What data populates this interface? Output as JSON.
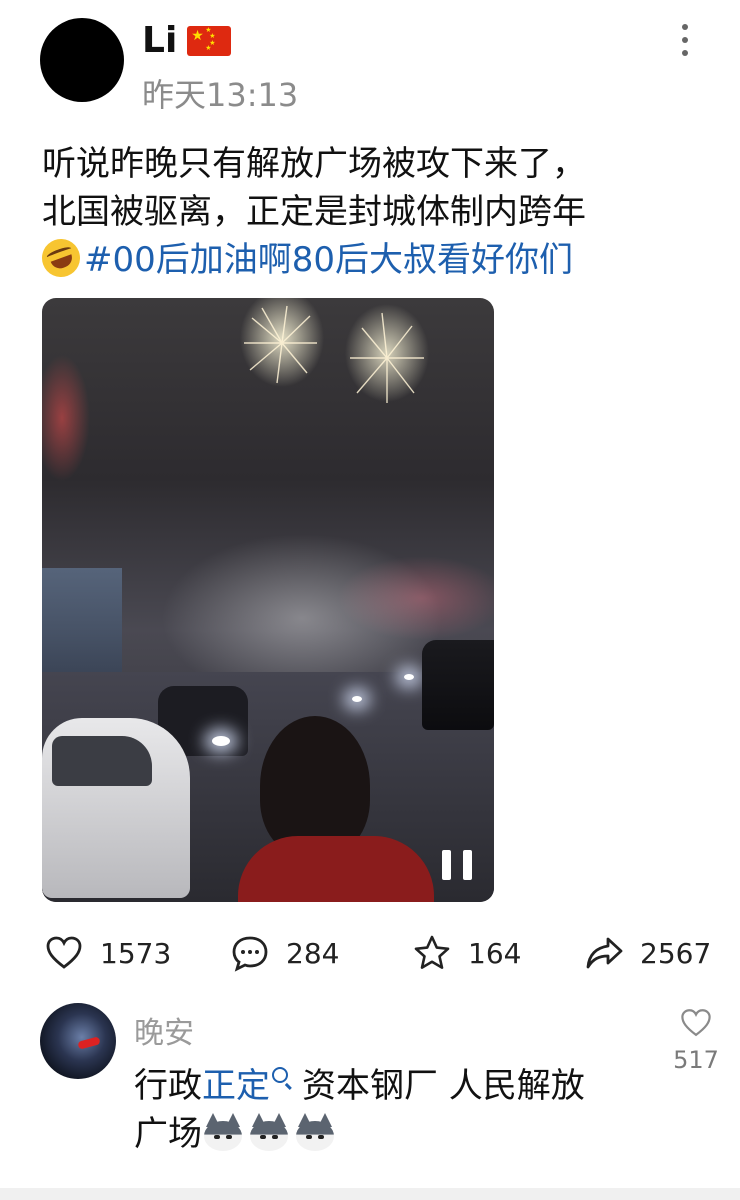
{
  "post": {
    "username": "Li",
    "flag_icon": "china-flag-icon",
    "timestamp": "昨天13:13",
    "text_line1": "听说昨晚只有解放广场被攻下来了，",
    "text_line2": "北国被驱离，正定是封城体制内跨年",
    "emoji": "rolling-on-floor-laughing-emoji",
    "hashtag": "#00后加油啊80后大叔看好你们"
  },
  "actions": {
    "like_count": "1573",
    "comment_count": "284",
    "favorite_count": "164",
    "share_count": "2567"
  },
  "comment": {
    "author": "晚安",
    "text_before_link": "行政",
    "link": "正定",
    "text_after_link": "资本钢厂 人民解放",
    "text_line2": "广场",
    "emoji": "husky-dog-emoji",
    "like_count": "517"
  },
  "colors": {
    "link": "#1d5fae",
    "meta_gray": "#8b8b8b",
    "text": "#111111"
  }
}
